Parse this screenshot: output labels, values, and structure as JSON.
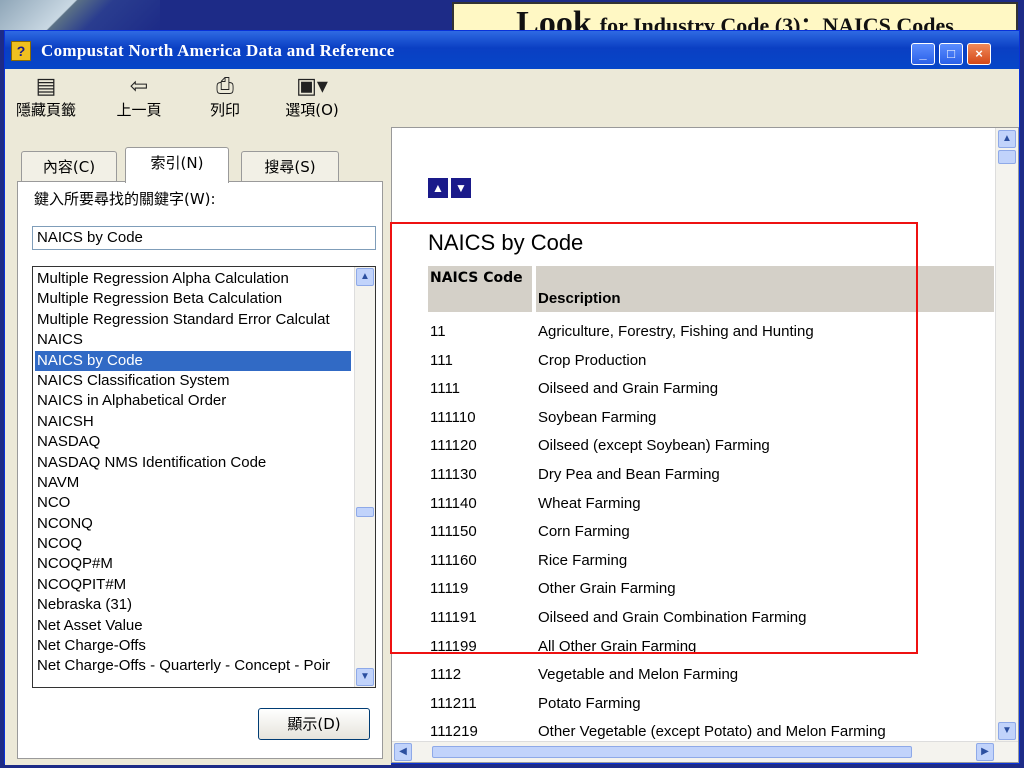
{
  "slide_title": {
    "main": "Look",
    "rest": "for Industry Code (3)：NAICS Codes"
  },
  "window": {
    "title": "Compustat North America Data and Reference",
    "controls": {
      "minimize": "_",
      "maximize": "□",
      "close": "×"
    }
  },
  "toolbar": {
    "hide_tabs": "隱藏頁籤",
    "back": "上一頁",
    "print": "列印",
    "options": "選項(O)"
  },
  "tabs": {
    "contents": "內容(C)",
    "index": "索引(N)",
    "search": "搜尋(S)"
  },
  "index_panel": {
    "keyword_label": "鍵入所要尋找的關鍵字(W):",
    "keyword_value": "NAICS by Code",
    "items": [
      "Multiple Regression Alpha Calculation",
      "Multiple Regression Beta Calculation",
      "Multiple Regression Standard Error Calculat",
      "NAICS",
      "NAICS by Code",
      "NAICS Classification System",
      "NAICS in Alphabetical Order",
      "NAICSH",
      "NASDAQ",
      "NASDAQ  NMS  Identification Code",
      "NAVM",
      "NCO",
      "NCONQ",
      "NCOQ",
      "NCOQP#M",
      "NCOQPIT#M",
      "Nebraska (31)",
      "Net Asset Value",
      "Net Charge-Offs",
      "Net Charge-Offs - Quarterly - Concept - Poir"
    ],
    "selected_index": 4,
    "display_button": "顯示(D)"
  },
  "content": {
    "title": "NAICS by Code",
    "headers": {
      "code": "NAICS Code",
      "description": "Description"
    },
    "rows": [
      {
        "code": "11",
        "description": "Agriculture, Forestry, Fishing and Hunting"
      },
      {
        "code": "111",
        "description": "Crop Production"
      },
      {
        "code": "1111",
        "description": "Oilseed and Grain Farming"
      },
      {
        "code": "111110",
        "description": "Soybean Farming"
      },
      {
        "code": "111120",
        "description": "Oilseed (except Soybean) Farming"
      },
      {
        "code": "111130",
        "description": "Dry Pea and Bean Farming"
      },
      {
        "code": "111140",
        "description": "Wheat Farming"
      },
      {
        "code": "111150",
        "description": "Corn Farming"
      },
      {
        "code": "111160",
        "description": "Rice Farming"
      },
      {
        "code": "11119",
        "description": "Other Grain Farming"
      },
      {
        "code": "111191",
        "description": "Oilseed and Grain Combination Farming"
      },
      {
        "code": "111199",
        "description": "All Other Grain Farming"
      },
      {
        "code": "1112",
        "description": "Vegetable and Melon Farming"
      },
      {
        "code": "111211",
        "description": "Potato Farming"
      },
      {
        "code": "111219",
        "description": "Other Vegetable (except Potato) and Melon Farming"
      }
    ]
  },
  "colors": {
    "selection": "#316ac5",
    "highlight_box": "#ee1111",
    "slide_background": "#1d2b87",
    "slide_title_background": "#fff8c4"
  }
}
